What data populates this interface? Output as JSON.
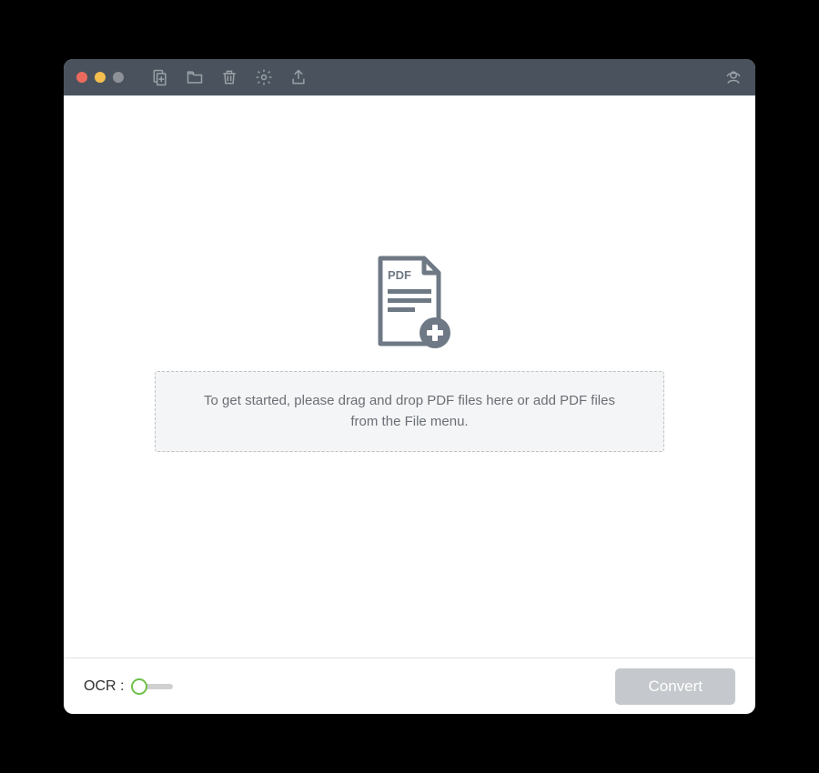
{
  "toolbar": {
    "add_file_icon": "add-file",
    "folder_icon": "folder",
    "trash_icon": "trash",
    "settings_icon": "settings",
    "export_icon": "export",
    "support_icon": "support"
  },
  "main": {
    "pdf_badge_label": "PDF",
    "dropzone_message": "To get started, please drag and drop PDF files here or add PDF files from the File menu."
  },
  "footer": {
    "ocr_label": "OCR :",
    "ocr_enabled": false,
    "convert_label": "Convert"
  },
  "colors": {
    "toolbar_bg": "#4a535d",
    "toolbar_icon": "#9aa0a6",
    "dropzone_bg": "#f4f5f6",
    "dropzone_border": "#c0c0c0",
    "dropzone_text": "#6a6f75",
    "ocr_accent": "#6fbf4a",
    "convert_bg": "#c5c8cc",
    "illustration": "#6f7985",
    "traffic_red": "#ed6a5e",
    "traffic_yellow": "#f5bf4f",
    "traffic_gray": "#8e9298"
  }
}
